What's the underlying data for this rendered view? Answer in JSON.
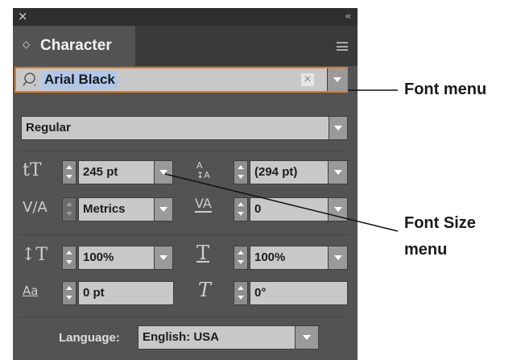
{
  "panel": {
    "close_glyph": "×",
    "collapse_glyph": "‹‹",
    "tab_arrows": "◇",
    "tab_label": "Character",
    "panel_menu_icon": "hamburger-menu-icon"
  },
  "font": {
    "family_value": "Arial Black",
    "clear_glyph": "×",
    "style_value": "Regular"
  },
  "size": {
    "font_size": "245 pt",
    "leading": "(294 pt)"
  },
  "spacing": {
    "kerning": "Metrics",
    "tracking": "0"
  },
  "scale": {
    "vertical": "100%",
    "horizontal": "100%"
  },
  "shift": {
    "baseline": "0 pt",
    "rotation": "0°"
  },
  "language": {
    "label": "Language:",
    "value": "English: USA"
  },
  "icons": {
    "font_size_icon": "tT",
    "leading_icon": "A/A",
    "kerning_icon": "V/A",
    "tracking_icon": "VA",
    "vertical_scale_icon": "↕T",
    "horizontal_scale_icon": "T",
    "baseline_icon": "Aa",
    "rotation_icon": "T"
  },
  "callouts": {
    "font_menu": "Font menu",
    "font_size_menu_line1": "Font Size",
    "font_size_menu_line2": "menu"
  },
  "accent_color": "#e07b23"
}
